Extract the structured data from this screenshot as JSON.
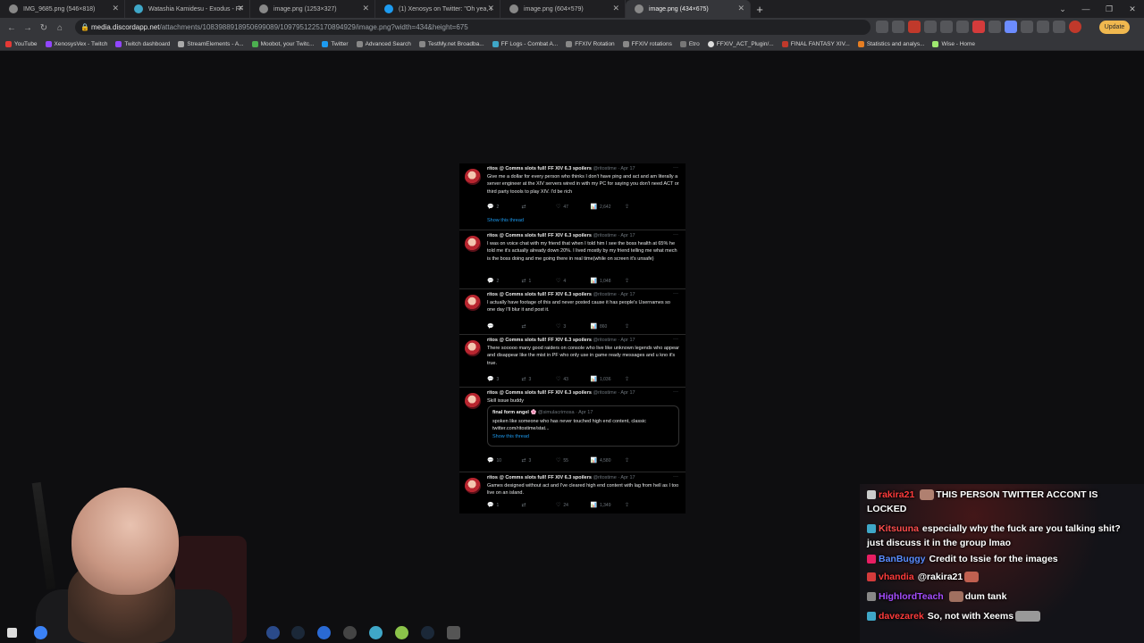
{
  "browser": {
    "tabs": [
      {
        "title": "IMG_9685.png (546×818)",
        "active": false
      },
      {
        "title": "Watashia Kamidesu - Exodus - FF",
        "active": false
      },
      {
        "title": "image.png (1253×327)",
        "active": false
      },
      {
        "title": "(1) Xenosys on Twitter: \"Oh yea, t",
        "active": false
      },
      {
        "title": "image.png (604×579)",
        "active": false
      },
      {
        "title": "image.png (434×675)",
        "active": true
      }
    ],
    "url_host": "media.discordapp.net",
    "url_path": "/attachments/1083988918950699089/1097951225170894929/image.png?width=434&height=675",
    "update_label": "Update",
    "bookmarks": [
      "YouTube",
      "XenosysVex - Twitch",
      "Twitch dashboard",
      "StreamElements - A...",
      "Moobot, your Twitc...",
      "Twitter",
      "Advanced Search",
      "TestMy.net Broadba...",
      "FF Logs - Combat A...",
      "FFXIV Rotation",
      "FFXIV rotations",
      "Etro",
      "FFXIV_ACT_Plugin/...",
      "FINAL FANTASY XIV...",
      "Statistics and analys...",
      "Wise - Home"
    ]
  },
  "tweets": [
    {
      "author": "ritos @ Comms slots full! FF XIV 6.3 spoilers",
      "handle": "@ritostime · Apr 17",
      "text": "Give me a dollar for every person who thinks I don't have ping and act and am literally a server engineer at the XIV servers wired in with my PC for saying you don't need ACT or third party toools to play XIV. I'd be rich",
      "replies": "2",
      "retweets": "",
      "likes": "47",
      "views": "2,642",
      "show_thread": "Show this thread"
    },
    {
      "author": "ritos @ Comms slots full! FF XIV 6.3 spoilers",
      "handle": "@ritostime · Apr 17",
      "text": "I was on voice chat with my friend that when I told him I see the boss health at 65% he told me it's actually already down 20%. I lived mostly by my friend telling me what mech is the boss doing and me going there in real time(while on screen it's unsafe)",
      "replies": "2",
      "retweets": "1",
      "likes": "4",
      "views": "1,048"
    },
    {
      "author": "ritos @ Comms slots full! FF XIV 6.3 spoilers",
      "handle": "@ritostime · Apr 17",
      "text": "I actually have footage of this and never posted cause it has people's Usernames so one day I'll blur it and post it.",
      "replies": "",
      "retweets": "",
      "likes": "3",
      "views": "860"
    },
    {
      "author": "ritos @ Comms slots full! FF XIV 6.3 spoilers",
      "handle": "@ritostime · Apr 17",
      "text": "There sooooo many good raiders on console who live like unknown legends who appear and disappear like the mist in PF who only use in game ready messages and u kno it's true.",
      "replies": "3",
      "retweets": "3",
      "likes": "43",
      "views": "1,036"
    },
    {
      "author": "ritos @ Comms slots full! FF XIV 6.3 spoilers",
      "handle": "@ritostime · Apr 17",
      "text": "Skill issue buddy",
      "replies": "10",
      "retweets": "3",
      "likes": "55",
      "views": "4,580",
      "quote": {
        "author": "final form angel 🌸",
        "handle": "@simulacrimosa · Apr 17",
        "text": "spoken like someone who has never touched high end content, classic twitter.com/ritostime/stat...",
        "link": "Show this thread"
      }
    },
    {
      "author": "ritos @ Comms slots full! FF XIV 6.3 spoilers",
      "handle": "@ritostime · Apr 17",
      "text": "Games designed without act and I've cleared high end content with lag from hell as I too live on an island.",
      "replies": "1",
      "retweets": "",
      "likes": "24",
      "views": "1,349"
    }
  ],
  "chat": [
    {
      "user": "rakira21",
      "color": "#ff3b3b",
      "message": "THIS PERSON TWITTER ACCONT IS LOCKED"
    },
    {
      "user": "Kitsuuna",
      "color": "#ff4d4d",
      "message": "especially why the fuck are you talking shit? just discuss it in the group lmao"
    },
    {
      "user": "BanBuggy",
      "color": "#5a8cff",
      "message": "Credit to Issie for the images"
    },
    {
      "user": "vhandia",
      "color": "#ff3b3b",
      "message": "@rakira21"
    },
    {
      "user": "HighlordTeach",
      "color": "#a64dff",
      "message": "dum tank"
    },
    {
      "user": "davezarek",
      "color": "#ff3b3b",
      "message": "So, not with Xeems"
    }
  ],
  "colors": {
    "page_bg": "#0e0e10",
    "link": "#1d9bf0",
    "update": "#f0b84f"
  }
}
